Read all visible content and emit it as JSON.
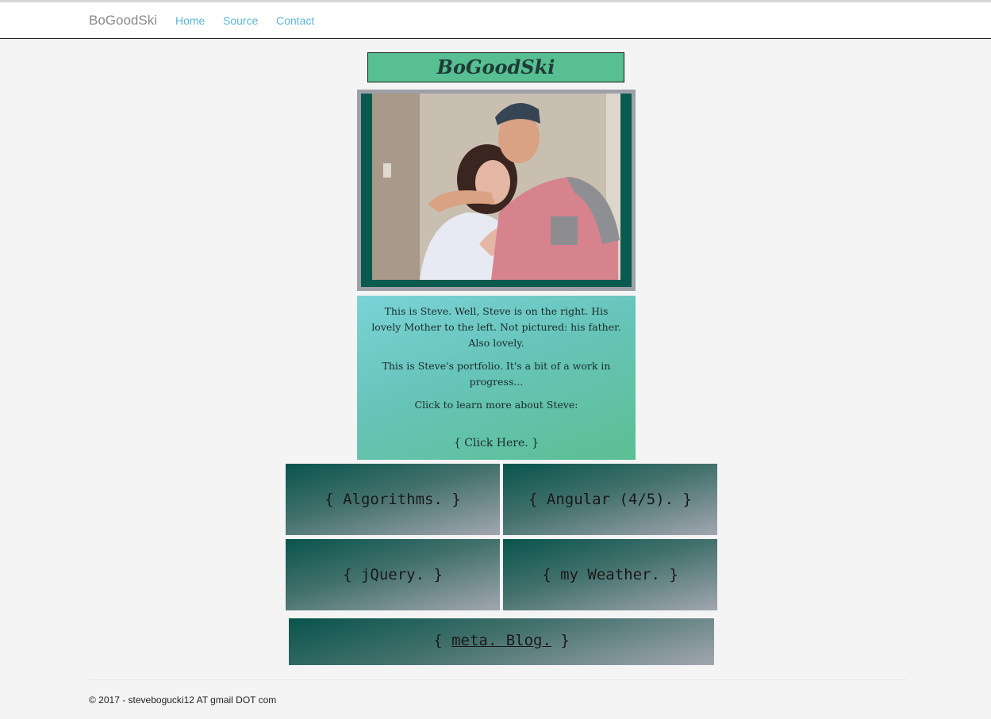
{
  "navbar": {
    "brand": "BoGoodSki",
    "links": [
      "Home",
      "Source",
      "Contact"
    ]
  },
  "title_banner": "BoGoodSki",
  "photo": {
    "alt_icon": "portrait-photo"
  },
  "about": {
    "p1": "This is Steve. Well, Steve is on the right. His lovely Mother to the left. Not pictured: his father. Also lovely.",
    "p2": "This is Steve's portfolio. It's a bit of a work in progress...",
    "p3": "Click to learn more about Steve:",
    "link": "{ Click Here. }"
  },
  "tiles": {
    "algorithms": "{ Algorithms. }",
    "angular": "{ Angular (4/5). }",
    "jquery": "{ jQuery. }",
    "weather": "{ my Weather. }",
    "blog_open": "{ ",
    "blog_label": "meta. Blog.",
    "blog_close": " }"
  },
  "footer": "© 2017 - stevebogucki12 AT gmail DOT com",
  "colors": {
    "accent_green": "#57bf91",
    "frame_green": "#0a5a4f",
    "link_blue": "#5bb7d9"
  }
}
